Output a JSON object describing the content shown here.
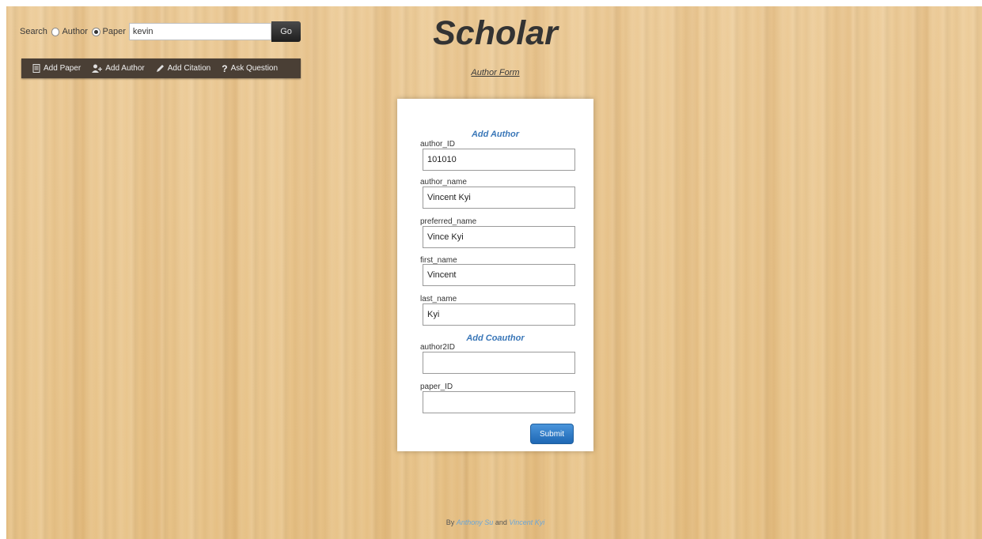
{
  "search": {
    "label": "Search",
    "options": [
      "Author",
      "Paper"
    ],
    "selected": "Paper",
    "value": "kevin",
    "go_label": "Go"
  },
  "nav": {
    "items": [
      {
        "label": "Add Paper",
        "icon": "document-icon"
      },
      {
        "label": "Add Author",
        "icon": "add-user-icon"
      },
      {
        "label": "Add Citation",
        "icon": "pencil-icon"
      },
      {
        "label": "Ask Question",
        "icon": "question-icon"
      }
    ]
  },
  "header": {
    "title": "Scholar",
    "subtitle": "Author Form"
  },
  "form": {
    "add_author_heading": "Add Author",
    "add_coauthor_heading": "Add Coauthor",
    "fields": [
      {
        "label": "author_ID",
        "value": "101010"
      },
      {
        "label": "author_name",
        "value": "Vincent Kyi"
      },
      {
        "label": "preferred_name",
        "value": "Vince Kyi"
      },
      {
        "label": "first_name",
        "value": "Vincent"
      },
      {
        "label": "last_name",
        "value": "Kyi"
      },
      {
        "label": "author2ID",
        "value": ""
      },
      {
        "label": "paper_ID",
        "value": ""
      }
    ],
    "submit_label": "Submit"
  },
  "footer": {
    "by": "By",
    "author1": "Anthony Su",
    "and": "and",
    "author2": "Vincent Kyi"
  },
  "colors": {
    "nav_bg": "#4a3f35",
    "accent": "#3a77b8",
    "submit": "#2a7bc8",
    "wood": "#e8c48a"
  }
}
